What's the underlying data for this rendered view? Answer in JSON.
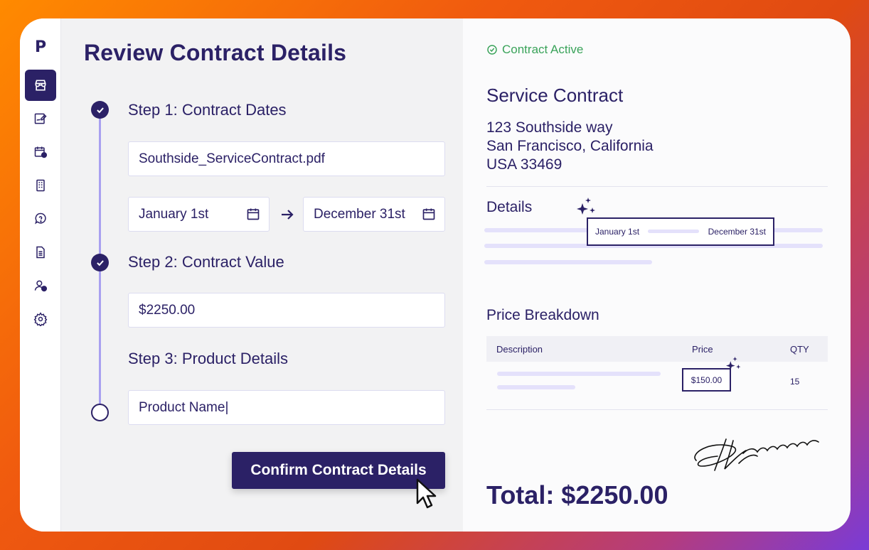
{
  "app": {
    "logo": "P"
  },
  "sidebar": {
    "items": [
      {
        "icon": "storefront-icon",
        "active": true
      },
      {
        "icon": "signed-document-icon"
      },
      {
        "icon": "calendar-clock-icon"
      },
      {
        "icon": "building-icon"
      },
      {
        "icon": "help-chat-icon"
      },
      {
        "icon": "document-icon"
      },
      {
        "icon": "user-clock-icon"
      },
      {
        "icon": "gear-icon"
      }
    ]
  },
  "form": {
    "title": "Review Contract Details",
    "steps": [
      {
        "label": "Step 1: Contract Dates",
        "status": "done"
      },
      {
        "label": "Step 2: Contract Value",
        "status": "done"
      },
      {
        "label": "Step 3: Product Details",
        "status": "todo"
      }
    ],
    "file_name": "Southside_ServiceContract.pdf",
    "start_date": "January 1st",
    "end_date": "December 31st",
    "value": "$2250.00",
    "product_name": "Product Name|",
    "confirm_label": "Confirm Contract Details"
  },
  "contract": {
    "status": "Contract Active",
    "title": "Service Contract",
    "address_line1": "123 Southside way",
    "address_line2": "San Francisco, California",
    "address_line3": "USA 33469",
    "details_title": "Details",
    "details_start": "January 1st",
    "details_end": "December 31st",
    "price_title": "Price Breakdown",
    "table_headers": {
      "description": "Description",
      "price": "Price",
      "qty": "QTY"
    },
    "row_price": "$150.00",
    "row_qty": "15",
    "total": "Total: $2250.00"
  },
  "colors": {
    "primary": "#2b2166",
    "accent_light": "#a9a1f0",
    "success": "#3aa35a"
  }
}
